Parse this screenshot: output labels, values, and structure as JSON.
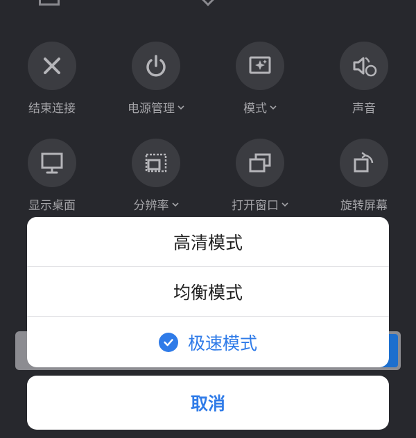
{
  "grid": {
    "row1": [
      {
        "label": "结束连接",
        "icon": "close-icon",
        "has_dropdown": false
      },
      {
        "label": "电源管理",
        "icon": "power-icon",
        "has_dropdown": true
      },
      {
        "label": "模式",
        "icon": "sparkle-screen-icon",
        "has_dropdown": true
      },
      {
        "label": "声音",
        "icon": "speaker-icon",
        "has_dropdown": false
      }
    ],
    "row2": [
      {
        "label": "显示桌面",
        "icon": "monitor-icon",
        "has_dropdown": false
      },
      {
        "label": "分辨率",
        "icon": "resolution-icon",
        "has_dropdown": true
      },
      {
        "label": "打开窗口",
        "icon": "windows-icon",
        "has_dropdown": true
      },
      {
        "label": "旋转屏幕",
        "icon": "rotate-screen-icon",
        "has_dropdown": false
      }
    ]
  },
  "sheet": {
    "options": [
      {
        "label": "高清模式",
        "selected": false
      },
      {
        "label": "均衡模式",
        "selected": false
      },
      {
        "label": "极速模式",
        "selected": true
      }
    ],
    "cancel_label": "取消"
  },
  "colors": {
    "background": "#27282d",
    "icon_circle": "#3b3c41",
    "label": "#a4a4a8",
    "accent": "#2f7be8"
  }
}
